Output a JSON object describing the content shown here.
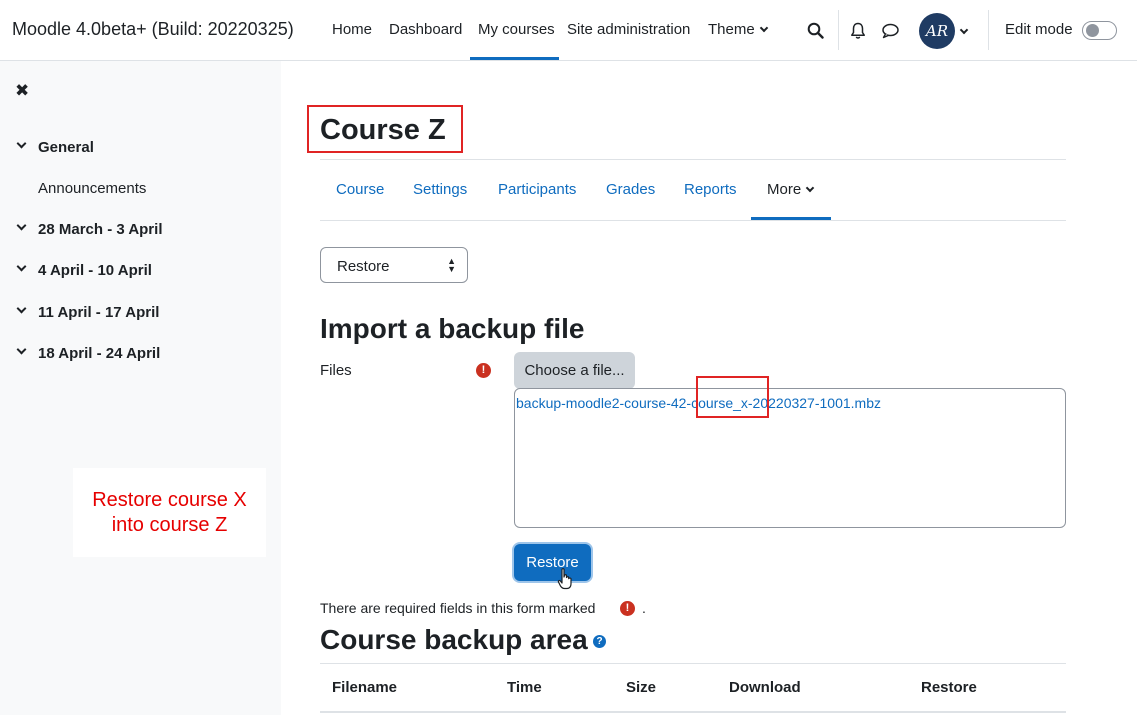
{
  "navbar": {
    "brand": "Moodle 4.0beta+ (Build: 20220325)",
    "links": [
      {
        "label": "Home"
      },
      {
        "label": "Dashboard"
      },
      {
        "label": "My courses"
      },
      {
        "label": "Site administration"
      },
      {
        "label": "Theme"
      }
    ],
    "active_link": "My courses",
    "avatar_initials": "AR",
    "edit_mode_label": "Edit mode",
    "edit_mode_on": false
  },
  "sidebar": {
    "items": [
      {
        "label": "General"
      },
      {
        "label": "Announcements"
      },
      {
        "label": "28 March - 3 April"
      },
      {
        "label": "4 April - 10 April"
      },
      {
        "label": "11 April - 17 April"
      },
      {
        "label": "18 April - 24 April"
      }
    ]
  },
  "annotation": {
    "line1": "Restore course X",
    "line2": "into course Z",
    "color": "#e60000"
  },
  "main": {
    "course_title": "Course Z",
    "tabs": [
      {
        "label": "Course"
      },
      {
        "label": "Settings"
      },
      {
        "label": "Participants"
      },
      {
        "label": "Grades"
      },
      {
        "label": "Reports"
      },
      {
        "label": "More"
      }
    ],
    "active_tab": "More",
    "select_value": "Restore",
    "import_heading": "Import a backup file",
    "files_label": "Files",
    "choose_file_label": "Choose a file...",
    "file_name": "backup-moodle2-course-42-course_x-20220327-1001.mbz",
    "restore_button": "Restore",
    "required_text": "There are required fields in this form marked",
    "required_suffix": ".",
    "backup_area_heading": "Course backup area",
    "table_headers": [
      "Filename",
      "Time",
      "Size",
      "Download",
      "Restore"
    ]
  },
  "colors": {
    "accent": "#0f6cbf",
    "required": "#ca3120",
    "highlight_box": "#e02424"
  }
}
